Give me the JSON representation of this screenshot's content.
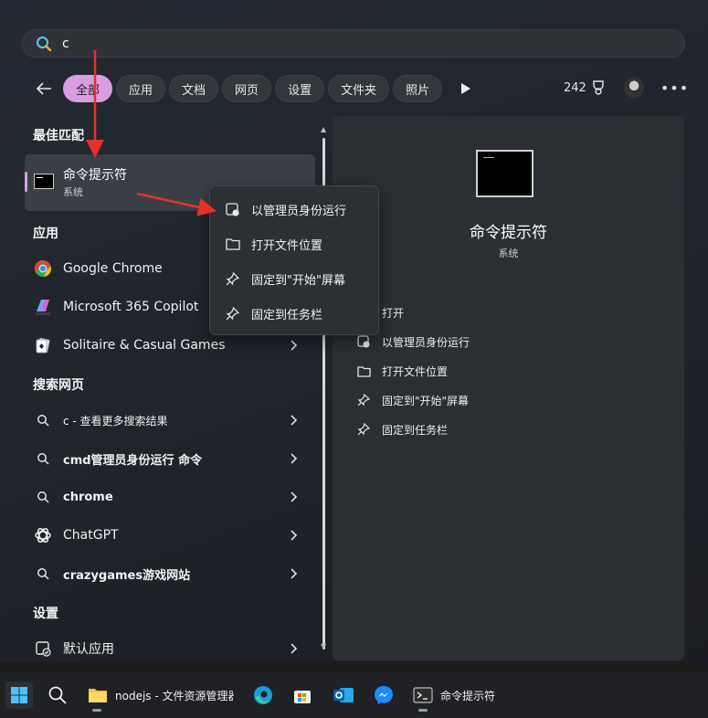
{
  "search": {
    "query": "c"
  },
  "filters": {
    "chips": [
      "全部",
      "应用",
      "文档",
      "网页",
      "设置",
      "文件夹",
      "照片"
    ],
    "active": "全部",
    "points": "242"
  },
  "best_match": {
    "heading": "最佳匹配",
    "title": "命令提示符",
    "subtitle": "系统"
  },
  "apps": {
    "heading": "应用",
    "items": [
      "Google Chrome",
      "Microsoft 365 Copilot",
      "Solitaire & Casual Games"
    ]
  },
  "web": {
    "heading": "搜索网页",
    "items": [
      "c - 查看更多搜索结果",
      "cmd管理员身份运行 命令",
      "chrome",
      "ChatGPT",
      "crazygames游戏网站"
    ]
  },
  "settings": {
    "heading": "设置",
    "items": [
      "默认应用"
    ]
  },
  "context_menu": {
    "items": [
      "以管理员身份运行",
      "打开文件位置",
      "固定到\"开始\"屏幕",
      "固定到任务栏"
    ]
  },
  "detail": {
    "name": "命令提示符",
    "type": "系统",
    "actions": [
      "打开",
      "以管理员身份运行",
      "打开文件位置",
      "固定到\"开始\"屏幕",
      "固定到任务栏"
    ]
  },
  "taskbar": {
    "explorer_label": "nodejs - 文件资源管理器",
    "cmd_label": "命令提示符"
  },
  "colors": {
    "accent": "#d89ee0",
    "annotation_red": "#e8302a"
  }
}
